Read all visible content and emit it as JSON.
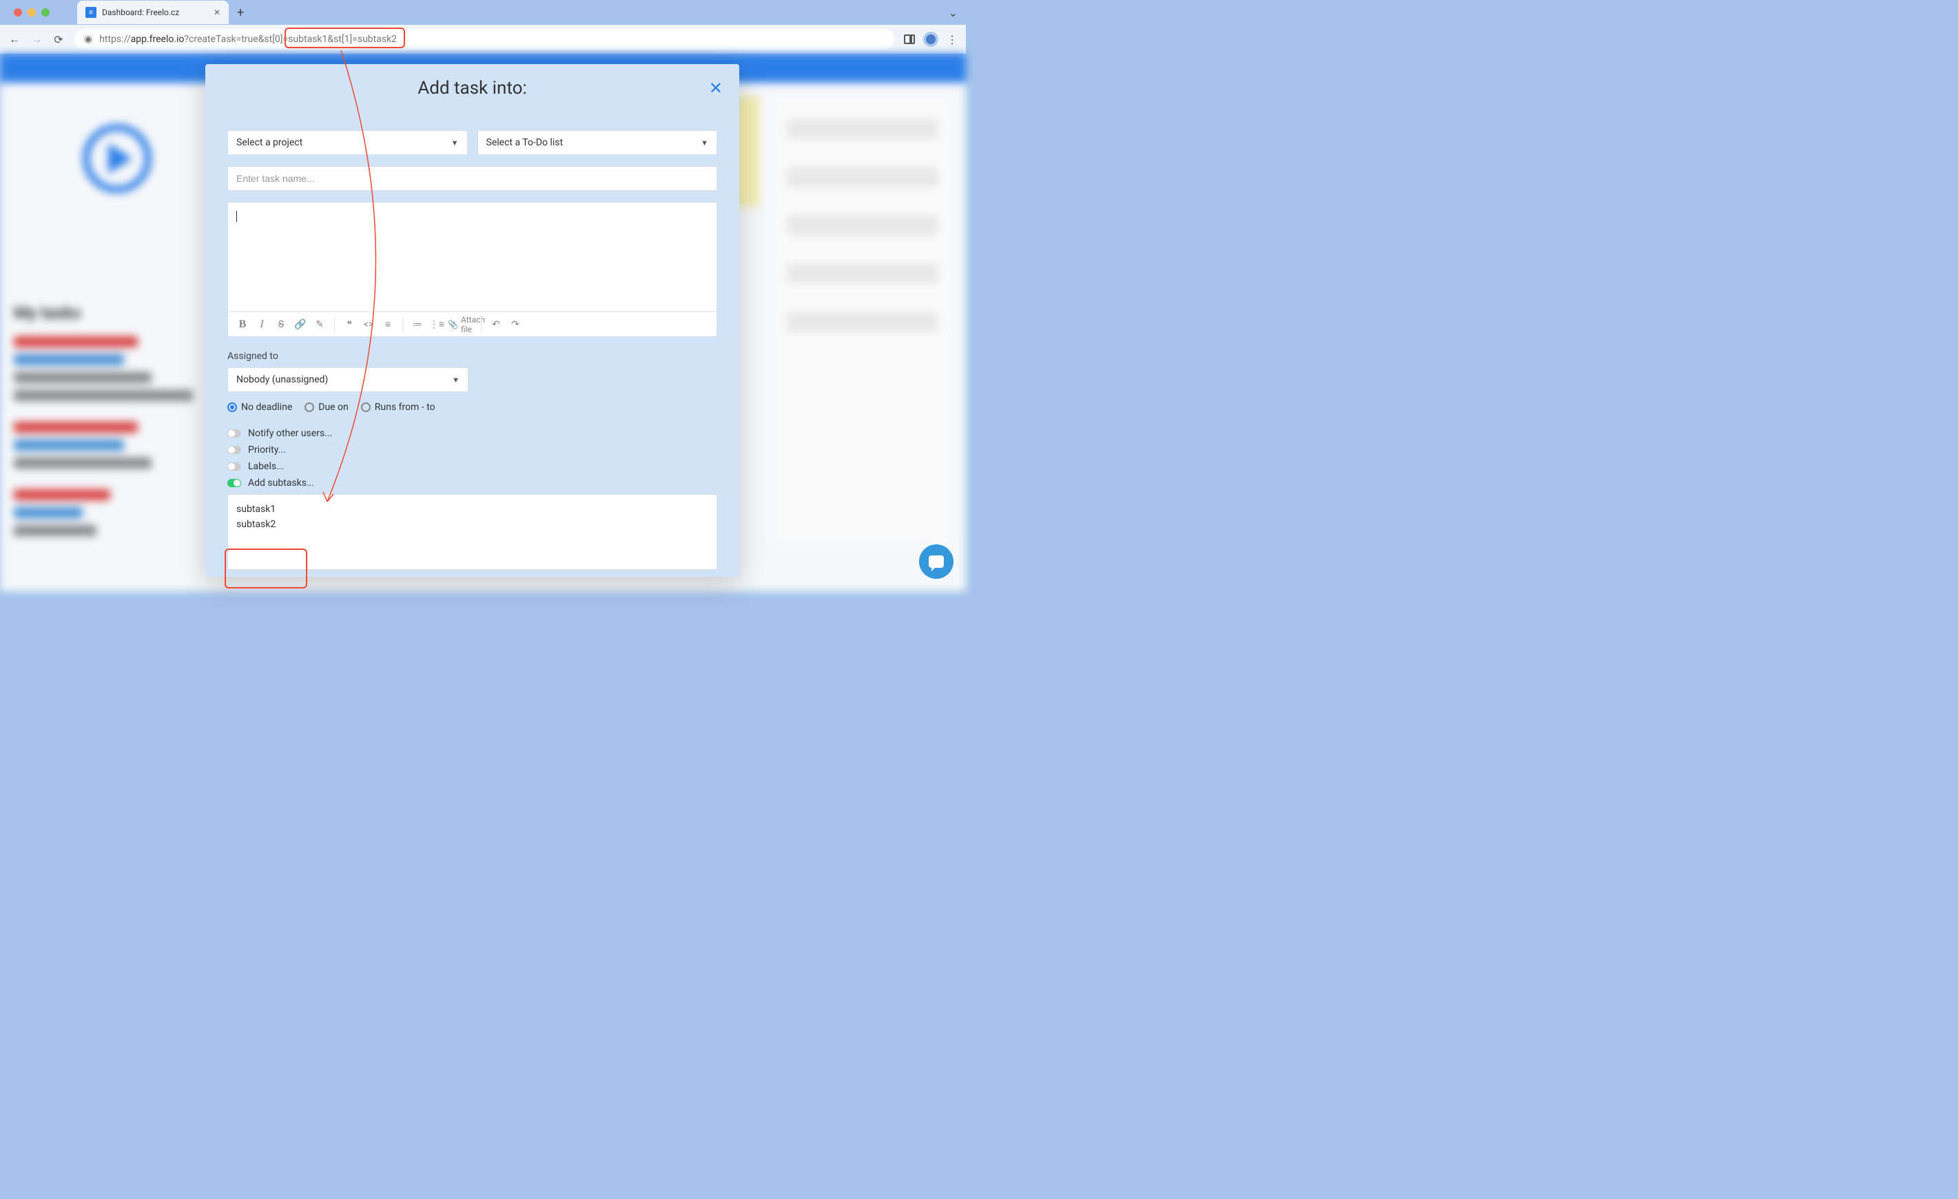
{
  "browser": {
    "tab_title": "Dashboard: Freelo.cz",
    "url_prefix": "https://",
    "url_host": "app.freelo.io",
    "url_path": "?createTask=true&st[0]=subtask1&st[1]=subtask2"
  },
  "modal": {
    "title": "Add task into:",
    "project_placeholder": "Select a project",
    "todo_placeholder": "Select a To-Do list",
    "task_name_placeholder": "Enter task name...",
    "attach_label": "Attach file",
    "assigned_label": "Assigned to",
    "assignee_value": "Nobody (unassigned)",
    "deadline": {
      "none": "No deadline",
      "due": "Due on",
      "runs": "Runs from - to"
    },
    "toggles": {
      "notify": "Notify other users...",
      "priority": "Priority...",
      "labels": "Labels...",
      "subtasks": "Add subtasks..."
    },
    "subtasks": [
      "subtask1",
      "subtask2"
    ]
  }
}
